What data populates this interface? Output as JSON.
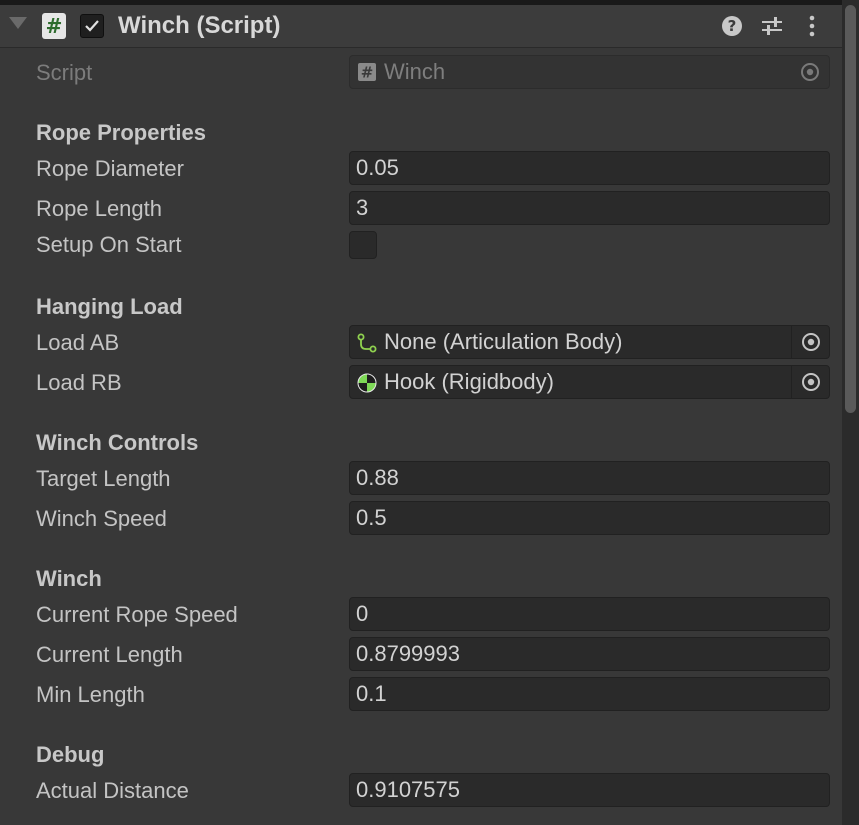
{
  "component": {
    "title": "Winch (Script)",
    "enabled": true,
    "icons": {
      "foldout": "chevron-down-icon",
      "script": "script-icon",
      "help": "help-icon",
      "presets": "presets-icon",
      "menu": "kebab-menu-icon"
    }
  },
  "script_field": {
    "label": "Script",
    "value": "Winch"
  },
  "sections": {
    "rope_properties": "Rope Properties",
    "hanging_load": "Hanging Load",
    "winch_controls": "Winch Controls",
    "winch": "Winch",
    "debug": "Debug"
  },
  "fields": {
    "rope_diameter": {
      "label": "Rope Diameter",
      "value": "0.05"
    },
    "rope_length": {
      "label": "Rope Length",
      "value": "3"
    },
    "setup_on_start": {
      "label": "Setup On Start",
      "checked": false
    },
    "load_ab": {
      "label": "Load AB",
      "value": "None (Articulation Body)"
    },
    "load_rb": {
      "label": "Load RB",
      "value": "Hook (Rigidbody)"
    },
    "target_length": {
      "label": "Target Length",
      "value": "0.88"
    },
    "winch_speed": {
      "label": "Winch Speed",
      "value": "0.5"
    },
    "current_rope_speed": {
      "label": "Current Rope Speed",
      "value": "0"
    },
    "current_length": {
      "label": "Current Length",
      "value": "0.8799993"
    },
    "min_length": {
      "label": "Min Length",
      "value": "0.1"
    },
    "actual_distance": {
      "label": "Actual Distance",
      "value": "0.9107575"
    }
  },
  "colors": {
    "background": "#383838",
    "field": "#2a2a2a",
    "script_icon_green": "#2d6b2d",
    "articulation_icon": "#8fd14f",
    "rigidbody_icon": "#7ed957"
  }
}
